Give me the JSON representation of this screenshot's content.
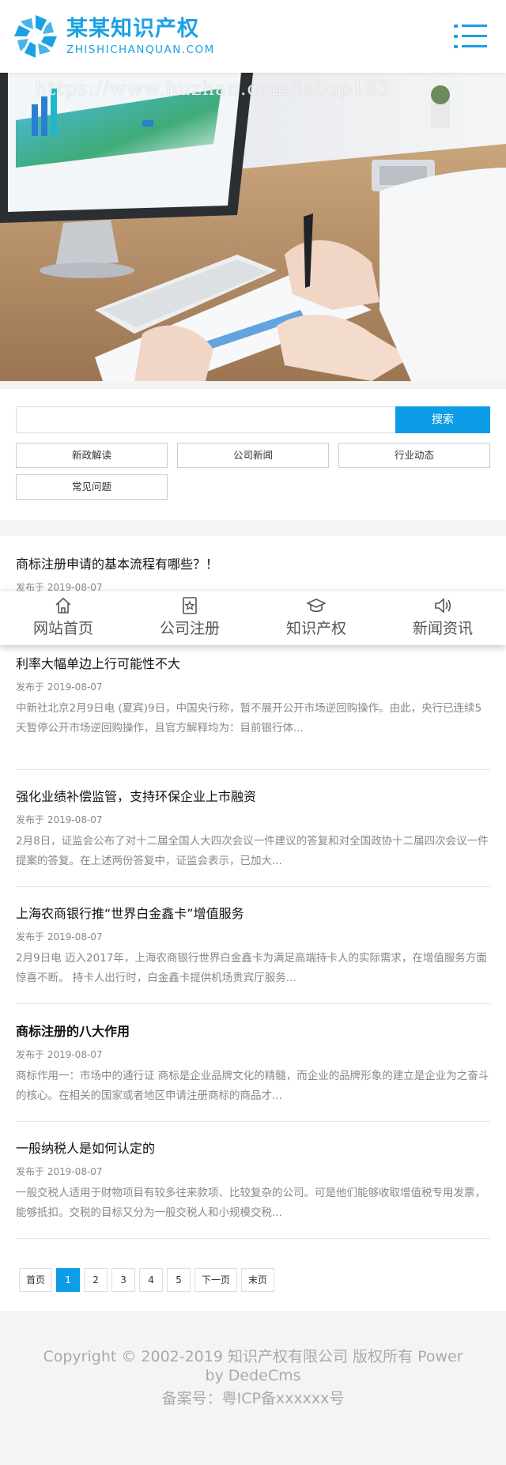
{
  "header": {
    "logo_cn": "某某知识产权",
    "logo_en": "ZHISHICHANQUAN.COM"
  },
  "banner": {
    "watermark": "https://www.huzhan.com/ishop163"
  },
  "search": {
    "placeholder": "",
    "button_label": "搜索",
    "tags": [
      "新政解读",
      "公司新闻",
      "行业动态",
      "常见问题"
    ]
  },
  "bottom_nav": [
    {
      "label": "网站首页",
      "icon": "home-icon"
    },
    {
      "label": "公司注册",
      "icon": "star-badge-icon"
    },
    {
      "label": "知识产权",
      "icon": "graduation-cap-icon"
    },
    {
      "label": "新闻资讯",
      "icon": "speaker-icon"
    }
  ],
  "articles": [
    {
      "title": "商标注册申请的基本流程有哪些？！",
      "date": "发布于 2019-08-07",
      "desc": ""
    },
    {
      "title": "利率大幅单边上行可能性不大",
      "date": "发布于 2019-08-07",
      "desc": "中新社北京2月9日电 (夏宾)9日，中国央行称，暂不展开公开市场逆回购操作。由此，央行已连续5天暂停公开市场逆回购操作，且官方解释均为：目前银行体..."
    },
    {
      "title": "强化业绩补偿监管，支持环保企业上市融资",
      "date": "发布于 2019-08-07",
      "desc": "2月8日，证监会公布了对十二届全国人大四次会议一件建议的答复和对全国政协十二届四次会议一件提案的答复。在上述两份答复中，证监会表示，已加大..."
    },
    {
      "title": "上海农商银行推“世界白金鑫卡”增值服务",
      "date": "发布于 2019-08-07",
      "desc": "2月9日电 迈入2017年，上海农商银行世界白金鑫卡为满足高端持卡人的实际需求，在增值服务方面惊喜不断。 持卡人出行时，白金鑫卡提供机场贵宾厅服务..."
    },
    {
      "title": "商标注册的八大作用",
      "date": "发布于 2019-08-07",
      "desc": "商标作用一：市场中的通行证 商标是企业品牌文化的精髓，而企业的品牌形象的建立是企业为之奋斗的核心。在相关的国家或者地区申请注册商标的商品才..."
    },
    {
      "title": "一般纳税人是如何认定的",
      "date": "发布于 2019-08-07",
      "desc": "一般交税人适用于财物项目有较多往来款项、比较复杂的公司。可是他们能够收取增值税专用发票，能够抵扣。交税的目标又分为一般交税人和小规模交税..."
    }
  ],
  "pagination": {
    "first": "首页",
    "pages": [
      "1",
      "2",
      "3",
      "4",
      "5"
    ],
    "next": "下一页",
    "last": "末页",
    "current": "1"
  },
  "footer": {
    "copyright": "Copyright © 2002-2019 知识产权有限公司 版权所有 Power by DedeCms",
    "icp": "备案号：粤ICP备xxxxxx号"
  },
  "colors": {
    "accent": "#0d9de6",
    "logo": "#1aa1e3"
  }
}
